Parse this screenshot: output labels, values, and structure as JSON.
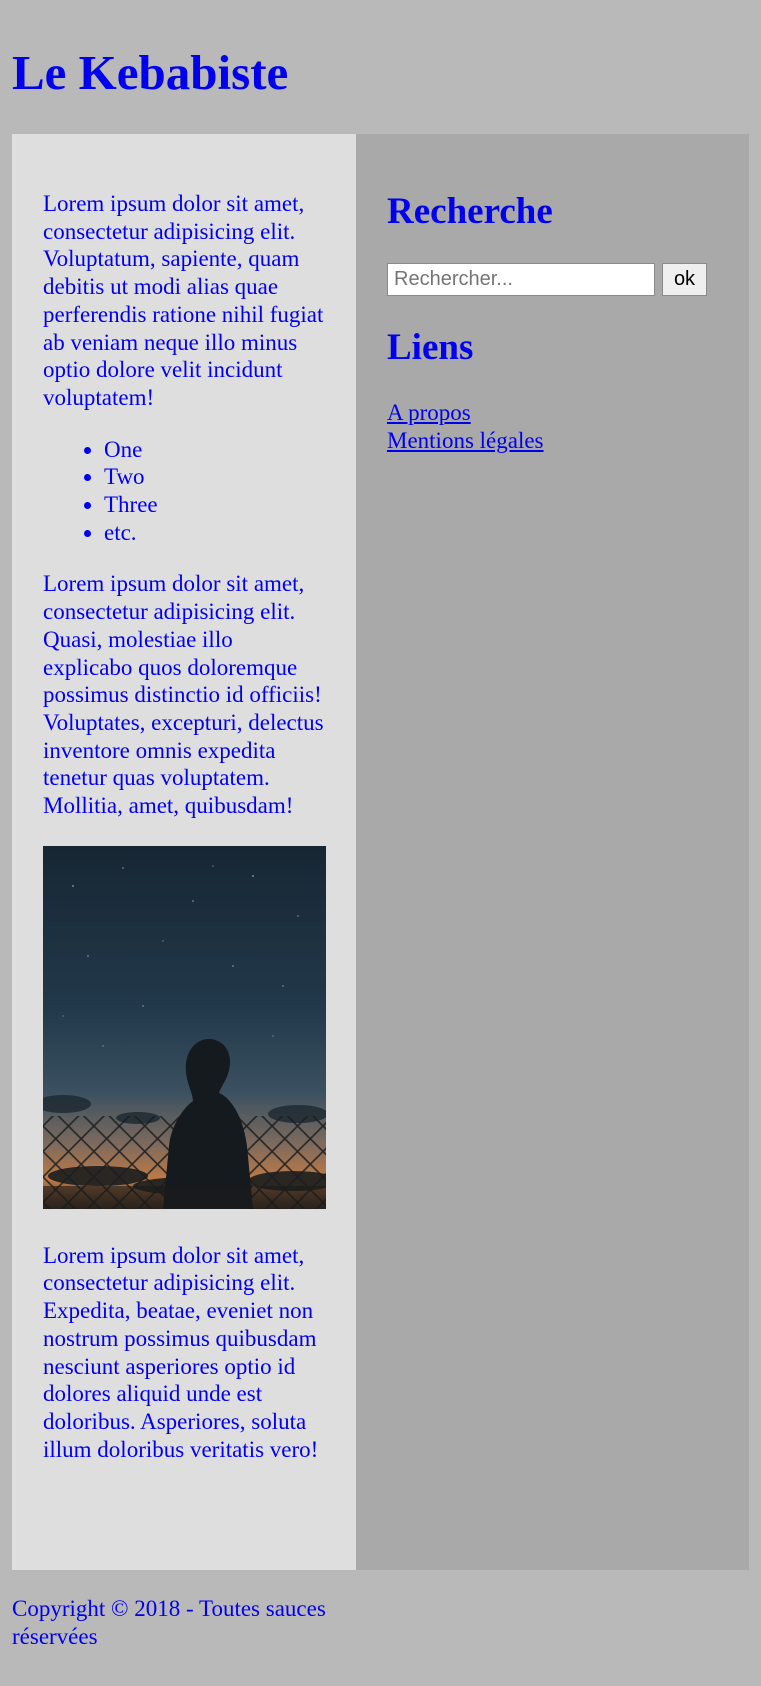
{
  "header": {
    "title": "Le Kebabiste"
  },
  "main": {
    "paragraph1": "Lorem ipsum dolor sit amet, consectetur adipisicing elit. Voluptatum, sapiente, quam debitis ut modi alias quae perferendis ratione nihil fugiat ab veniam neque illo minus optio dolore velit incidunt voluptatem!",
    "list": [
      "One",
      "Two",
      "Three",
      "etc."
    ],
    "paragraph2": "Lorem ipsum dolor sit amet, consectetur adipisicing elit. Quasi, molestiae illo explicabo quos doloremque possimus distinctio id officiis! Voluptates, excepturi, delectus inventore omnis expedita tenetur quas voluptatem. Mollitia, amet, quibusdam!",
    "paragraph3": "Lorem ipsum dolor sit amet, consectetur adipisicing elit. Expedita, beatae, eveniet non nostrum possimus quibusdam nesciunt asperiores optio id dolores aliquid unde est doloribus. Asperiores, soluta illum doloribus veritatis vero!"
  },
  "aside": {
    "search_heading": "Recherche",
    "search_placeholder": "Rechercher...",
    "search_button": "ok",
    "links_heading": "Liens",
    "links": [
      "A propos",
      "Mentions légales"
    ]
  },
  "footer": {
    "text": "Copyright © 2018 - Toutes sauces réservées"
  },
  "colors": {
    "page_background": "#b9b9b9",
    "main_background": "#dedede",
    "aside_background": "#a9a9a9",
    "text": "#0000ee"
  }
}
